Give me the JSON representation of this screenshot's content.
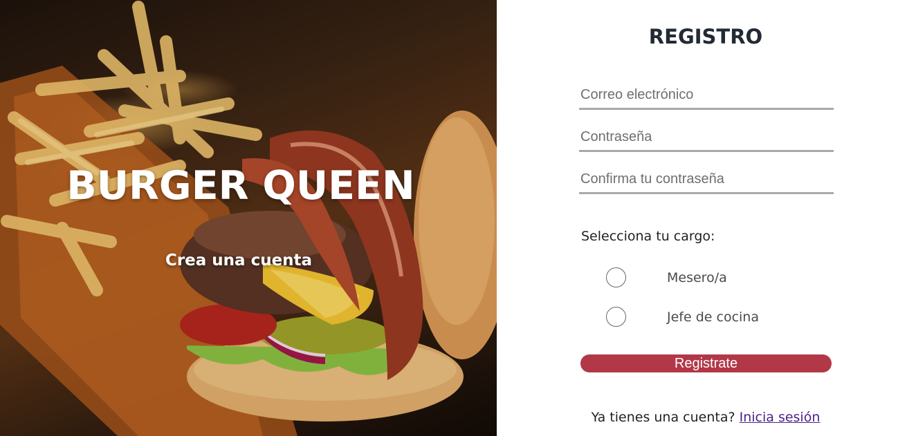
{
  "hero": {
    "title": "BURGER QUEEN",
    "subtitle": "Crea una cuenta"
  },
  "form": {
    "title": "REGISTRO",
    "email_placeholder": "Correo electrónico",
    "password_placeholder": "Contraseña",
    "confirm_placeholder": "Confirma tu contraseña",
    "role_label": "Selecciona tu cargo:",
    "roles": [
      {
        "label": "Mesero/a",
        "selected": false
      },
      {
        "label": "Jefe de cocina",
        "selected": false
      }
    ],
    "submit_label": "Registrate",
    "login_prompt": "Ya tienes una cuenta?",
    "login_link": "Inicia sesión"
  },
  "colors": {
    "accent": "#b23747",
    "title": "#222a33",
    "input_border": "#a9a9a9",
    "link": "#4b1f8c"
  }
}
